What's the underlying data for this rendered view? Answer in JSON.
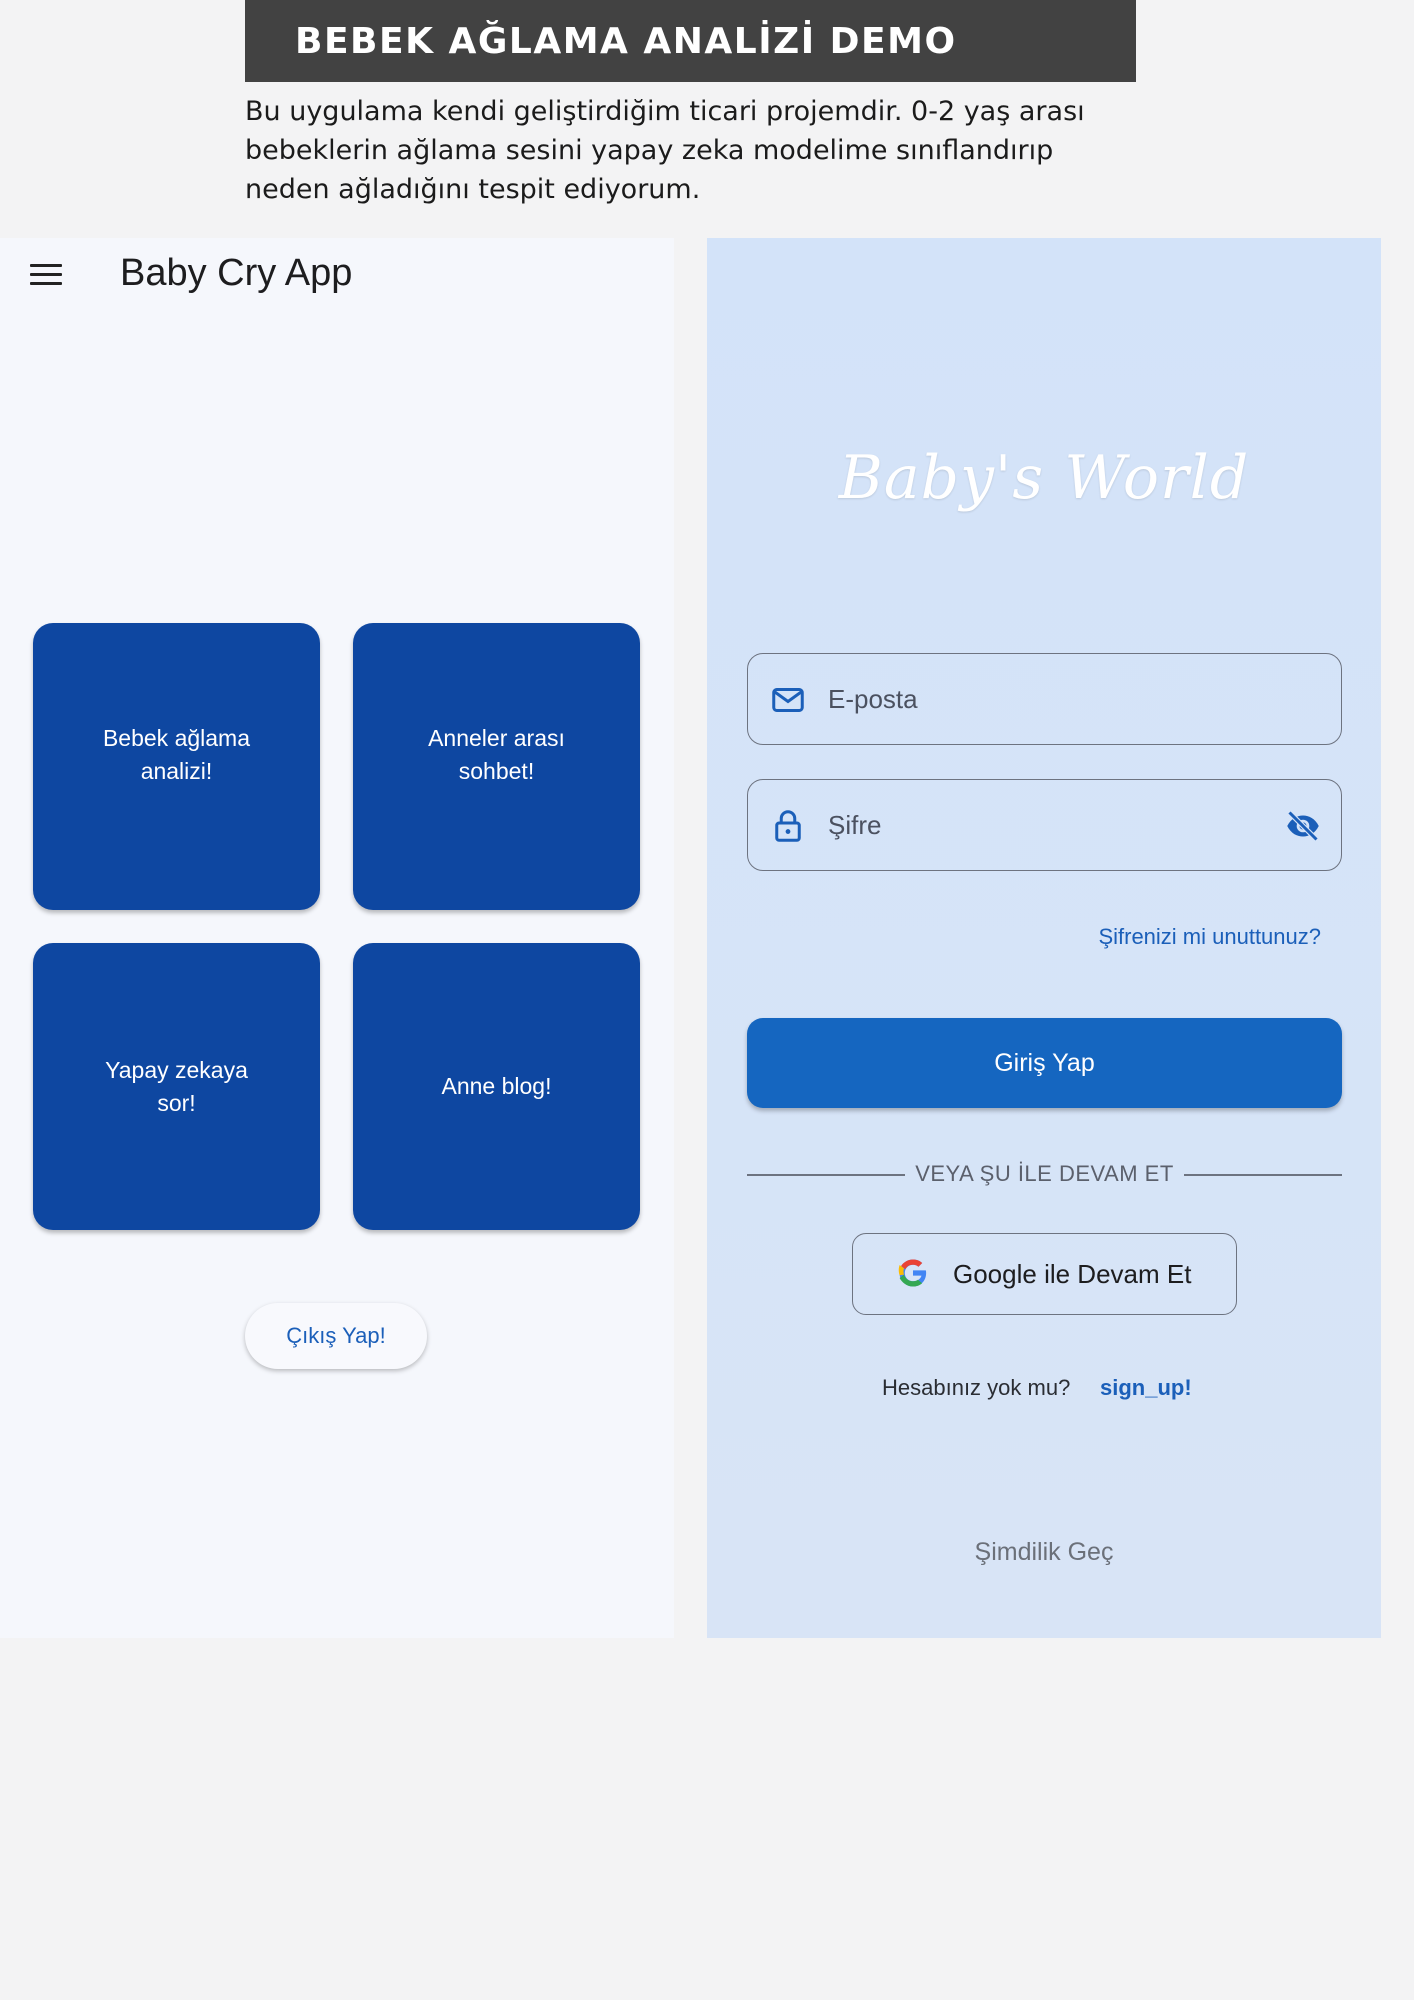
{
  "banner": {
    "title": "BEBEK AĞLAMA ANALİZİ DEMO",
    "description": "Bu uygulama kendi geliştirdiğim ticari projemdir. 0-2 yaş arası bebeklerin ağlama sesini yapay zeka modelime sınıflandırıp neden ağladığını tespit ediyorum."
  },
  "home_screen": {
    "app_title": "Baby Cry App",
    "menu_icon": "hamburger-menu-icon",
    "tiles": [
      {
        "label": "Bebek ağlama analizi!"
      },
      {
        "label": "Anneler arası sohbet!"
      },
      {
        "label": "Yapay zekaya sor!"
      },
      {
        "label": "Anne blog!"
      }
    ],
    "logout_label": "Çıkış Yap!",
    "colors": {
      "background": "#f5f7fc",
      "tile": "#0e47a1",
      "link": "#1b5fb9"
    }
  },
  "login_screen": {
    "brand": "Baby's World",
    "email": {
      "placeholder": "E-posta",
      "value": "",
      "icon": "mail-icon"
    },
    "password": {
      "placeholder": "Şifre",
      "value": "",
      "icon": "lock-icon",
      "toggle_icon": "eye-off-icon"
    },
    "forgot_label": "Şifrenizi mi unuttunuz?",
    "login_label": "Giriş Yap",
    "divider_text": "VEYA ŞU İLE DEVAM ET",
    "google_label": "Google ile Devam Et",
    "no_account_text": "Hesabınız yok mu?",
    "signup_label": "sign_up!",
    "skip_label": "Şimdilik Geç",
    "colors": {
      "background": "#d3e3f9",
      "primary": "#1566c0",
      "link": "#1b5fb9"
    }
  }
}
